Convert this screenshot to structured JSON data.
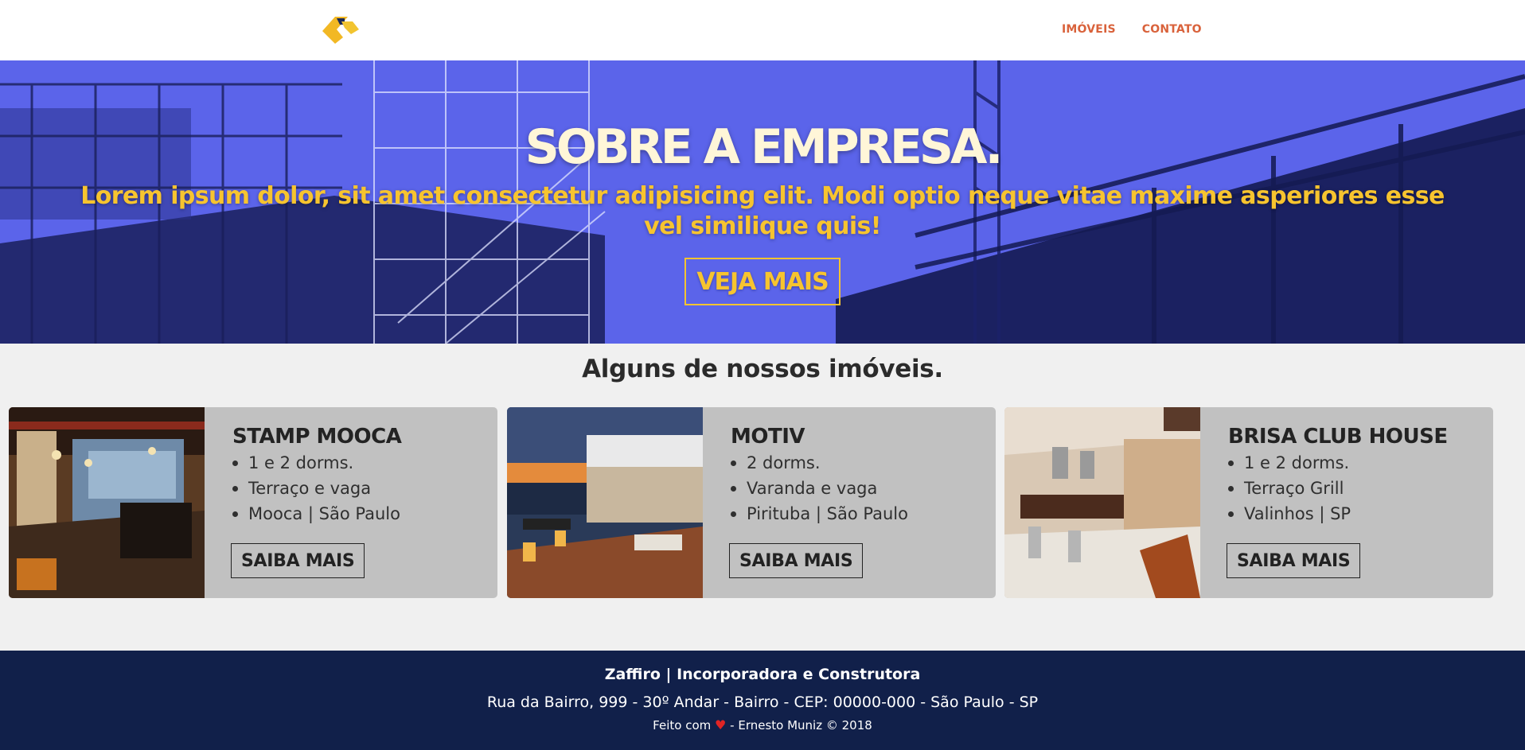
{
  "header": {
    "logo_icon": "zaffiro-logo",
    "nav": [
      {
        "label": "IMÓVEIS"
      },
      {
        "label": "CONTATO"
      }
    ]
  },
  "hero": {
    "title": "SOBRE A EMPRESA.",
    "subtitle": "Lorem ipsum dolor, sit amet consectetur adipisicing elit. Modi optio neque vitae maxime asperiores esse vel similique quis!",
    "button_label": "VEJA MAIS"
  },
  "section": {
    "title": "Alguns de nossos imóveis."
  },
  "cards": [
    {
      "name": "STAMP MOOCA",
      "features": [
        "1 e 2 dorms.",
        "Terraço e vaga",
        "Mooca | São Paulo"
      ],
      "button_label": "SAIBA MAIS"
    },
    {
      "name": "MOTIV",
      "features": [
        "2 dorms.",
        "Varanda e vaga",
        "Pirituba | São Paulo"
      ],
      "button_label": "SAIBA MAIS"
    },
    {
      "name": "BRISA CLUB HOUSE",
      "features": [
        "1 e 2 dorms.",
        "Terraço Grill",
        "Valinhos | SP"
      ],
      "button_label": "SAIBA MAIS"
    }
  ],
  "footer": {
    "company": "Zaffiro | Incorporadora e Construtora",
    "address": "Rua da Bairro, 999 - 30º Andar - Bairro - CEP: 00000-000 - São Paulo - SP",
    "made_with": "Feito com",
    "heart_icon": "heart-icon",
    "credit": "- Ernesto Muniz © 2018"
  },
  "colors": {
    "nav_accent": "#d9623b",
    "hero_overlay": "#5b63e8",
    "hero_accent": "#f7c42f",
    "card_bg": "#c1c1c1",
    "footer_bg": "#11204a"
  }
}
